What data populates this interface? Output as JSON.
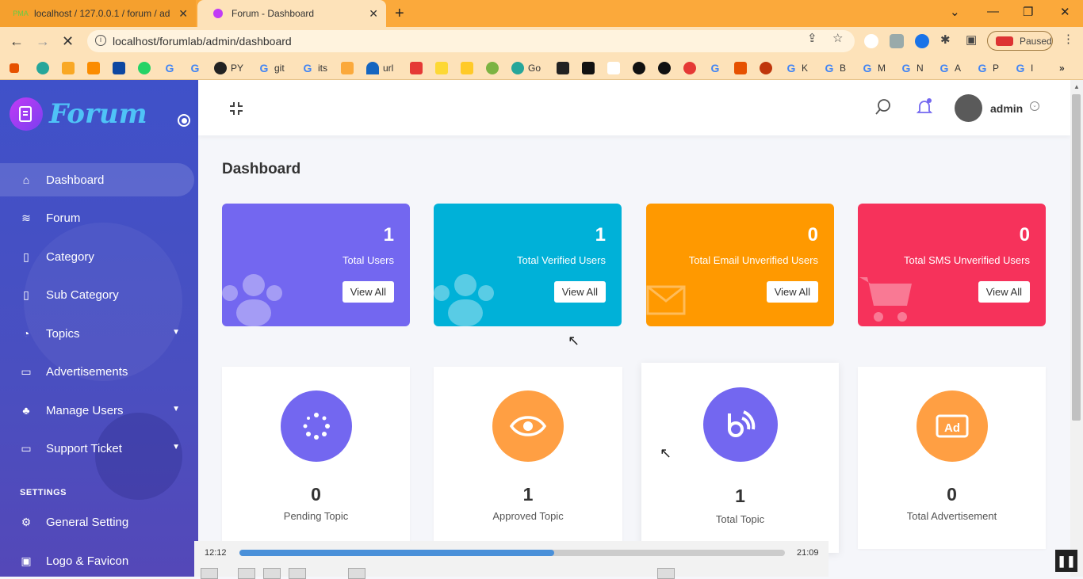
{
  "browser": {
    "tabs": [
      {
        "title": "localhost / 127.0.0.1 / forum / ad",
        "favicon": "PMA"
      },
      {
        "title": "Forum - Dashboard"
      }
    ],
    "url": "localhost/forumlab/admin/dashboard",
    "paused_label": "Paused",
    "bookmarks": [
      "PY",
      "git",
      "its",
      "url",
      "Go",
      "K",
      "B",
      "M",
      "N",
      "A",
      "P",
      "I"
    ]
  },
  "sidebar": {
    "brand": "Forum",
    "items": [
      {
        "label": "Dashboard",
        "icon": "home-icon"
      },
      {
        "label": "Forum",
        "icon": "layers-icon"
      },
      {
        "label": "Category",
        "icon": "bookmark-icon"
      },
      {
        "label": "Sub Category",
        "icon": "bookmark-icon"
      },
      {
        "label": "Topics",
        "icon": "rss-icon"
      },
      {
        "label": "Advertisements",
        "icon": "ad-icon"
      },
      {
        "label": "Manage Users",
        "icon": "users-icon"
      },
      {
        "label": "Support Ticket",
        "icon": "ticket-icon"
      }
    ],
    "settings_heading": "SETTINGS",
    "settings_items": [
      {
        "label": "General Setting",
        "icon": "gear-icon"
      },
      {
        "label": "Logo & Favicon",
        "icon": "image-icon"
      }
    ]
  },
  "header": {
    "user": "admin"
  },
  "page": {
    "title": "Dashboard"
  },
  "stats": [
    {
      "value": "1",
      "label": "Total Users",
      "button": "View All",
      "color": "#7367f0"
    },
    {
      "value": "1",
      "label": "Total Verified Users",
      "button": "View All",
      "color": "#00b1d8"
    },
    {
      "value": "0",
      "label": "Total Email Unverified Users",
      "button": "View All",
      "color": "#ff9900"
    },
    {
      "value": "0",
      "label": "Total SMS Unverified Users",
      "button": "View All",
      "color": "#f6325b"
    }
  ],
  "cards": [
    {
      "value": "0",
      "label": "Pending Topic",
      "color": "#7367f0",
      "icon": "spinner-icon"
    },
    {
      "value": "1",
      "label": "Approved Topic",
      "color": "#ff9f43",
      "icon": "eye-icon"
    },
    {
      "value": "1",
      "label": "Total Topic",
      "color": "#7367f0",
      "icon": "rss-icon"
    },
    {
      "value": "0",
      "label": "Total Advertisement",
      "color": "#ff9f43",
      "icon": "ad-icon"
    }
  ],
  "video": {
    "current": "12:12",
    "total": "21:09",
    "progress": 0.577
  }
}
